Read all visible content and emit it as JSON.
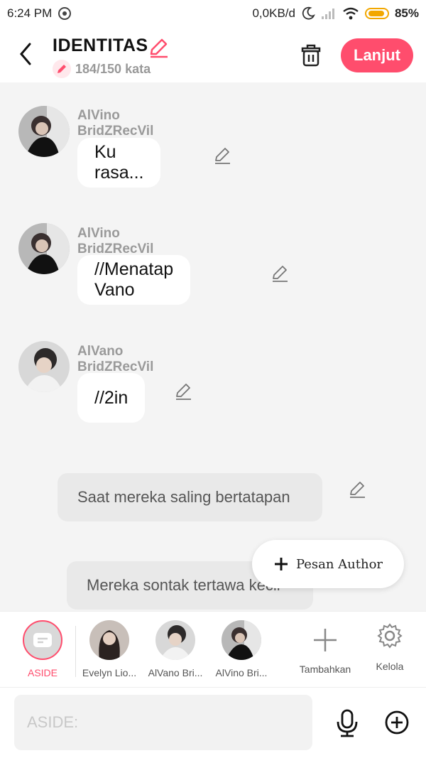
{
  "status_bar": {
    "time": "6:24 PM",
    "network_speed": "0,0KB/d",
    "battery": "85%"
  },
  "header": {
    "title": "IDENTITAS",
    "word_count": "184/150 kata",
    "next_label": "Lanjut"
  },
  "messages": [
    {
      "sender": "AlVino BridZRecVil",
      "text": "Ku rasa..."
    },
    {
      "sender": "AlVino BridZRecVil",
      "text": "//Menatap Vano"
    },
    {
      "sender": "AlVano BridZRecVil",
      "text": "//2in"
    }
  ],
  "narrations": [
    {
      "text": "Saat mereka saling bertatapan"
    },
    {
      "text": "Mereka sontak tertawa kecil"
    }
  ],
  "fab": {
    "label": "Pesan Author"
  },
  "characters": [
    {
      "label": "ASIDE",
      "color": "#ff4d6d"
    },
    {
      "label": "Evelyn Lio..."
    },
    {
      "label": "AlVano Bri..."
    },
    {
      "label": "AlVino Bri..."
    },
    {
      "label": "Tambahkan"
    },
    {
      "label": "Kelola"
    }
  ],
  "input": {
    "placeholder": "ASIDE:"
  },
  "colors": {
    "accent": "#ff4d6d",
    "background": "#f4f4f4"
  }
}
